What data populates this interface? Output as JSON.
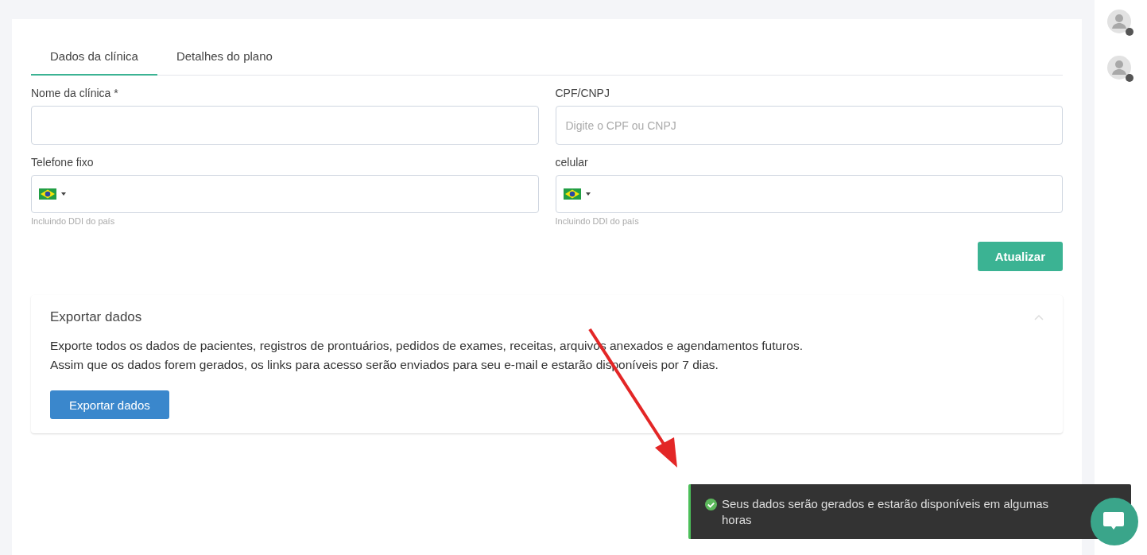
{
  "tabs": [
    {
      "label": "Dados da clínica",
      "selected": true
    },
    {
      "label": "Detalhes do plano",
      "selected": false
    }
  ],
  "fields": [
    {
      "kind": "text",
      "label": "Nome da clínica *"
    },
    {
      "kind": "text",
      "label": "CPF/CNPJ",
      "placeholder": "Digite o CPF ou CNPJ"
    },
    {
      "kind": "phone",
      "label": "Telefone fixo",
      "hint": "Incluindo DDI do país"
    },
    {
      "kind": "phone",
      "label": "celular",
      "hint": "Incluindo DDI do país"
    }
  ],
  "update_button": "Atualizar",
  "export_section": {
    "title": "Exportar dados",
    "expanded": true,
    "lines": [
      "Exporte todos os dados de pacientes, registros de prontuários, pedidos de exames, receitas, arquivos anexados e agendamentos futuros.",
      "Assim que os dados forem gerados, os links para acesso serão enviados para seu e-mail e estarão disponíveis por 7 dias."
    ],
    "button": "Exportar dados"
  },
  "toast": {
    "message": "Seus dados serão gerados e estarão disponíveis em algumas horas"
  }
}
